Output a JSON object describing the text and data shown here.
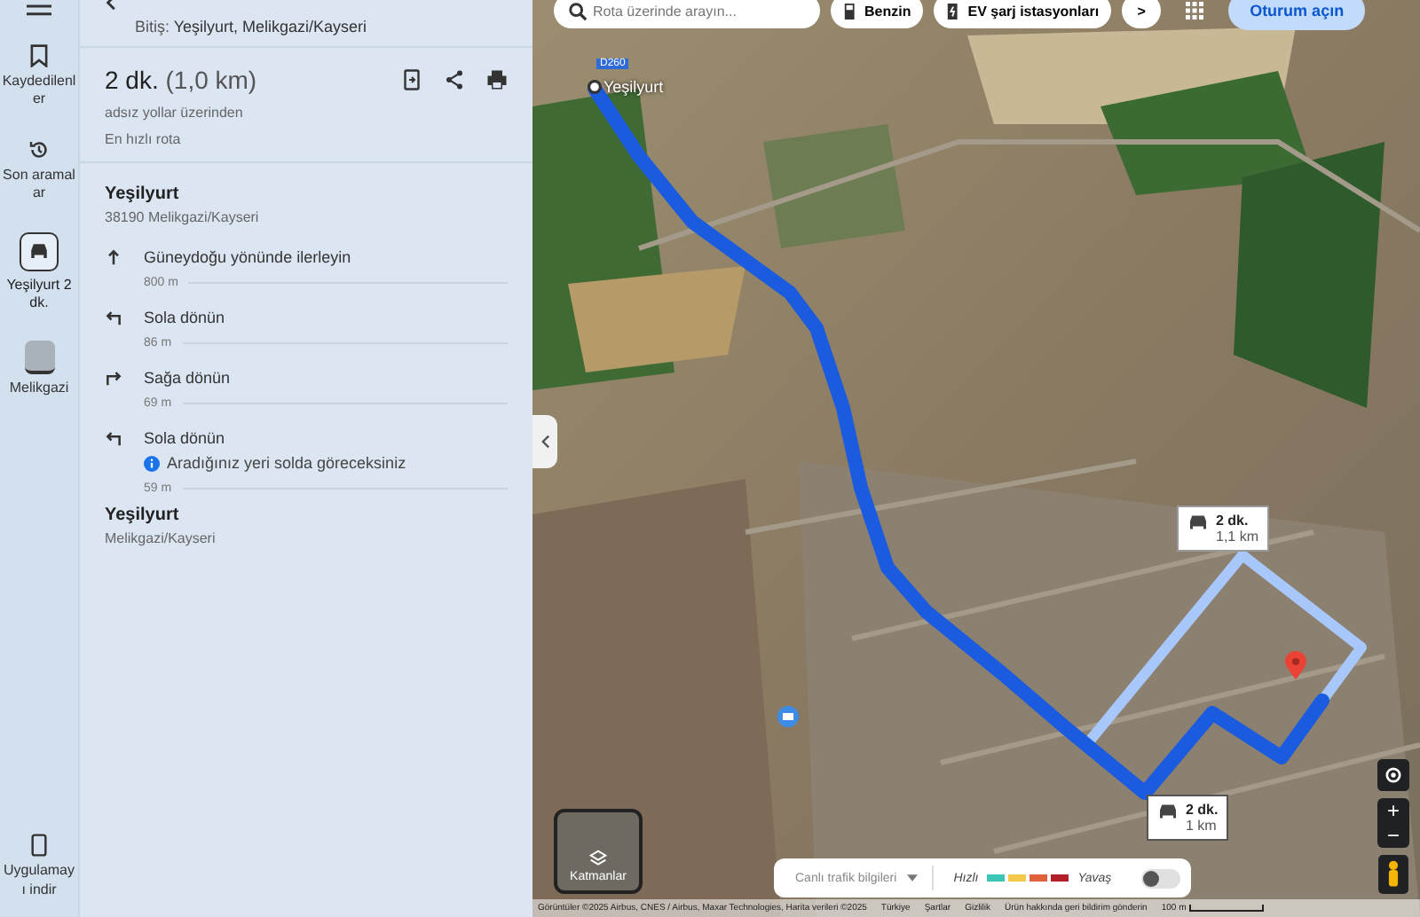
{
  "rail": {
    "items": [
      {
        "kind": "bookmark",
        "label": "Kaydedilenler",
        "selected": false
      },
      {
        "kind": "history",
        "label": "Son aramalar",
        "selected": false
      },
      {
        "kind": "car",
        "label": "Yeşilyurt 2 dk.",
        "selected": true
      },
      {
        "kind": "thumb",
        "label": "Melikgazi",
        "selected": false
      }
    ],
    "download": {
      "label": "Uygulamayı indir"
    }
  },
  "route": {
    "destination": "Bitiş: **Yeşilyurt, Melikgazi/Kayseri**",
    "time": "2 dk.",
    "distance": "(1,0 km)",
    "via": "adsız yollar üzerinden",
    "note": "En hızlı rota",
    "start": {
      "name": "Yeşilyurt",
      "address": "38190 Melikgazi/Kayseri"
    },
    "steps": [
      {
        "kind": "straight",
        "text": "Güneydoğu yönünde ilerleyin",
        "distance": "800 m"
      },
      {
        "kind": "left",
        "text": "Sola dönün",
        "distance": "86 m"
      },
      {
        "kind": "right",
        "text": "Sağa dönün",
        "distance": "69 m"
      },
      {
        "kind": "left",
        "text": "Sola dönün",
        "info": "Aradığınız yeri solda göreceksiniz",
        "distance": "59 m"
      }
    ],
    "end": {
      "name": "Yeşilyurt",
      "address": "Melikgazi/Kayseri"
    }
  },
  "map": {
    "search": {
      "placeholder": "Rota üzerinde arayın..."
    },
    "chips": [
      {
        "kind": "fuel",
        "label": "Benzin"
      },
      {
        "kind": "ev",
        "label": "EV şarj istasyonları"
      }
    ],
    "more": ">",
    "signin": "Oturum açın",
    "place_label": "Yeşilyurt",
    "road_sign": "D260",
    "callouts": [
      {
        "time": "2 dk.",
        "distance": "1,1 km",
        "selected": false
      },
      {
        "time": "2 dk.",
        "distance": "1 km",
        "selected": true
      }
    ],
    "zoom_in": "+",
    "zoom_out": "−",
    "layers": "Katmanlar",
    "traffic": {
      "label": "Canlı trafik bilgileri",
      "fast": "Hızlı",
      "slow": "Yavaş",
      "on": false,
      "legend": [
        {
          "color": "#3ec6b4"
        },
        {
          "color": "#f2c94c"
        },
        {
          "color": "#e0623a"
        },
        {
          "color": "#b3202a"
        }
      ]
    },
    "footer": [
      "Görüntüler ©2025 Airbus, CNES / Airbus, Maxar Technologies, Harita verileri ©2025",
      "Türkiye",
      "Şartlar",
      "Gizlilik",
      "Ürün hakkında geri bildirim gönderin"
    ],
    "scale": "100 m"
  }
}
